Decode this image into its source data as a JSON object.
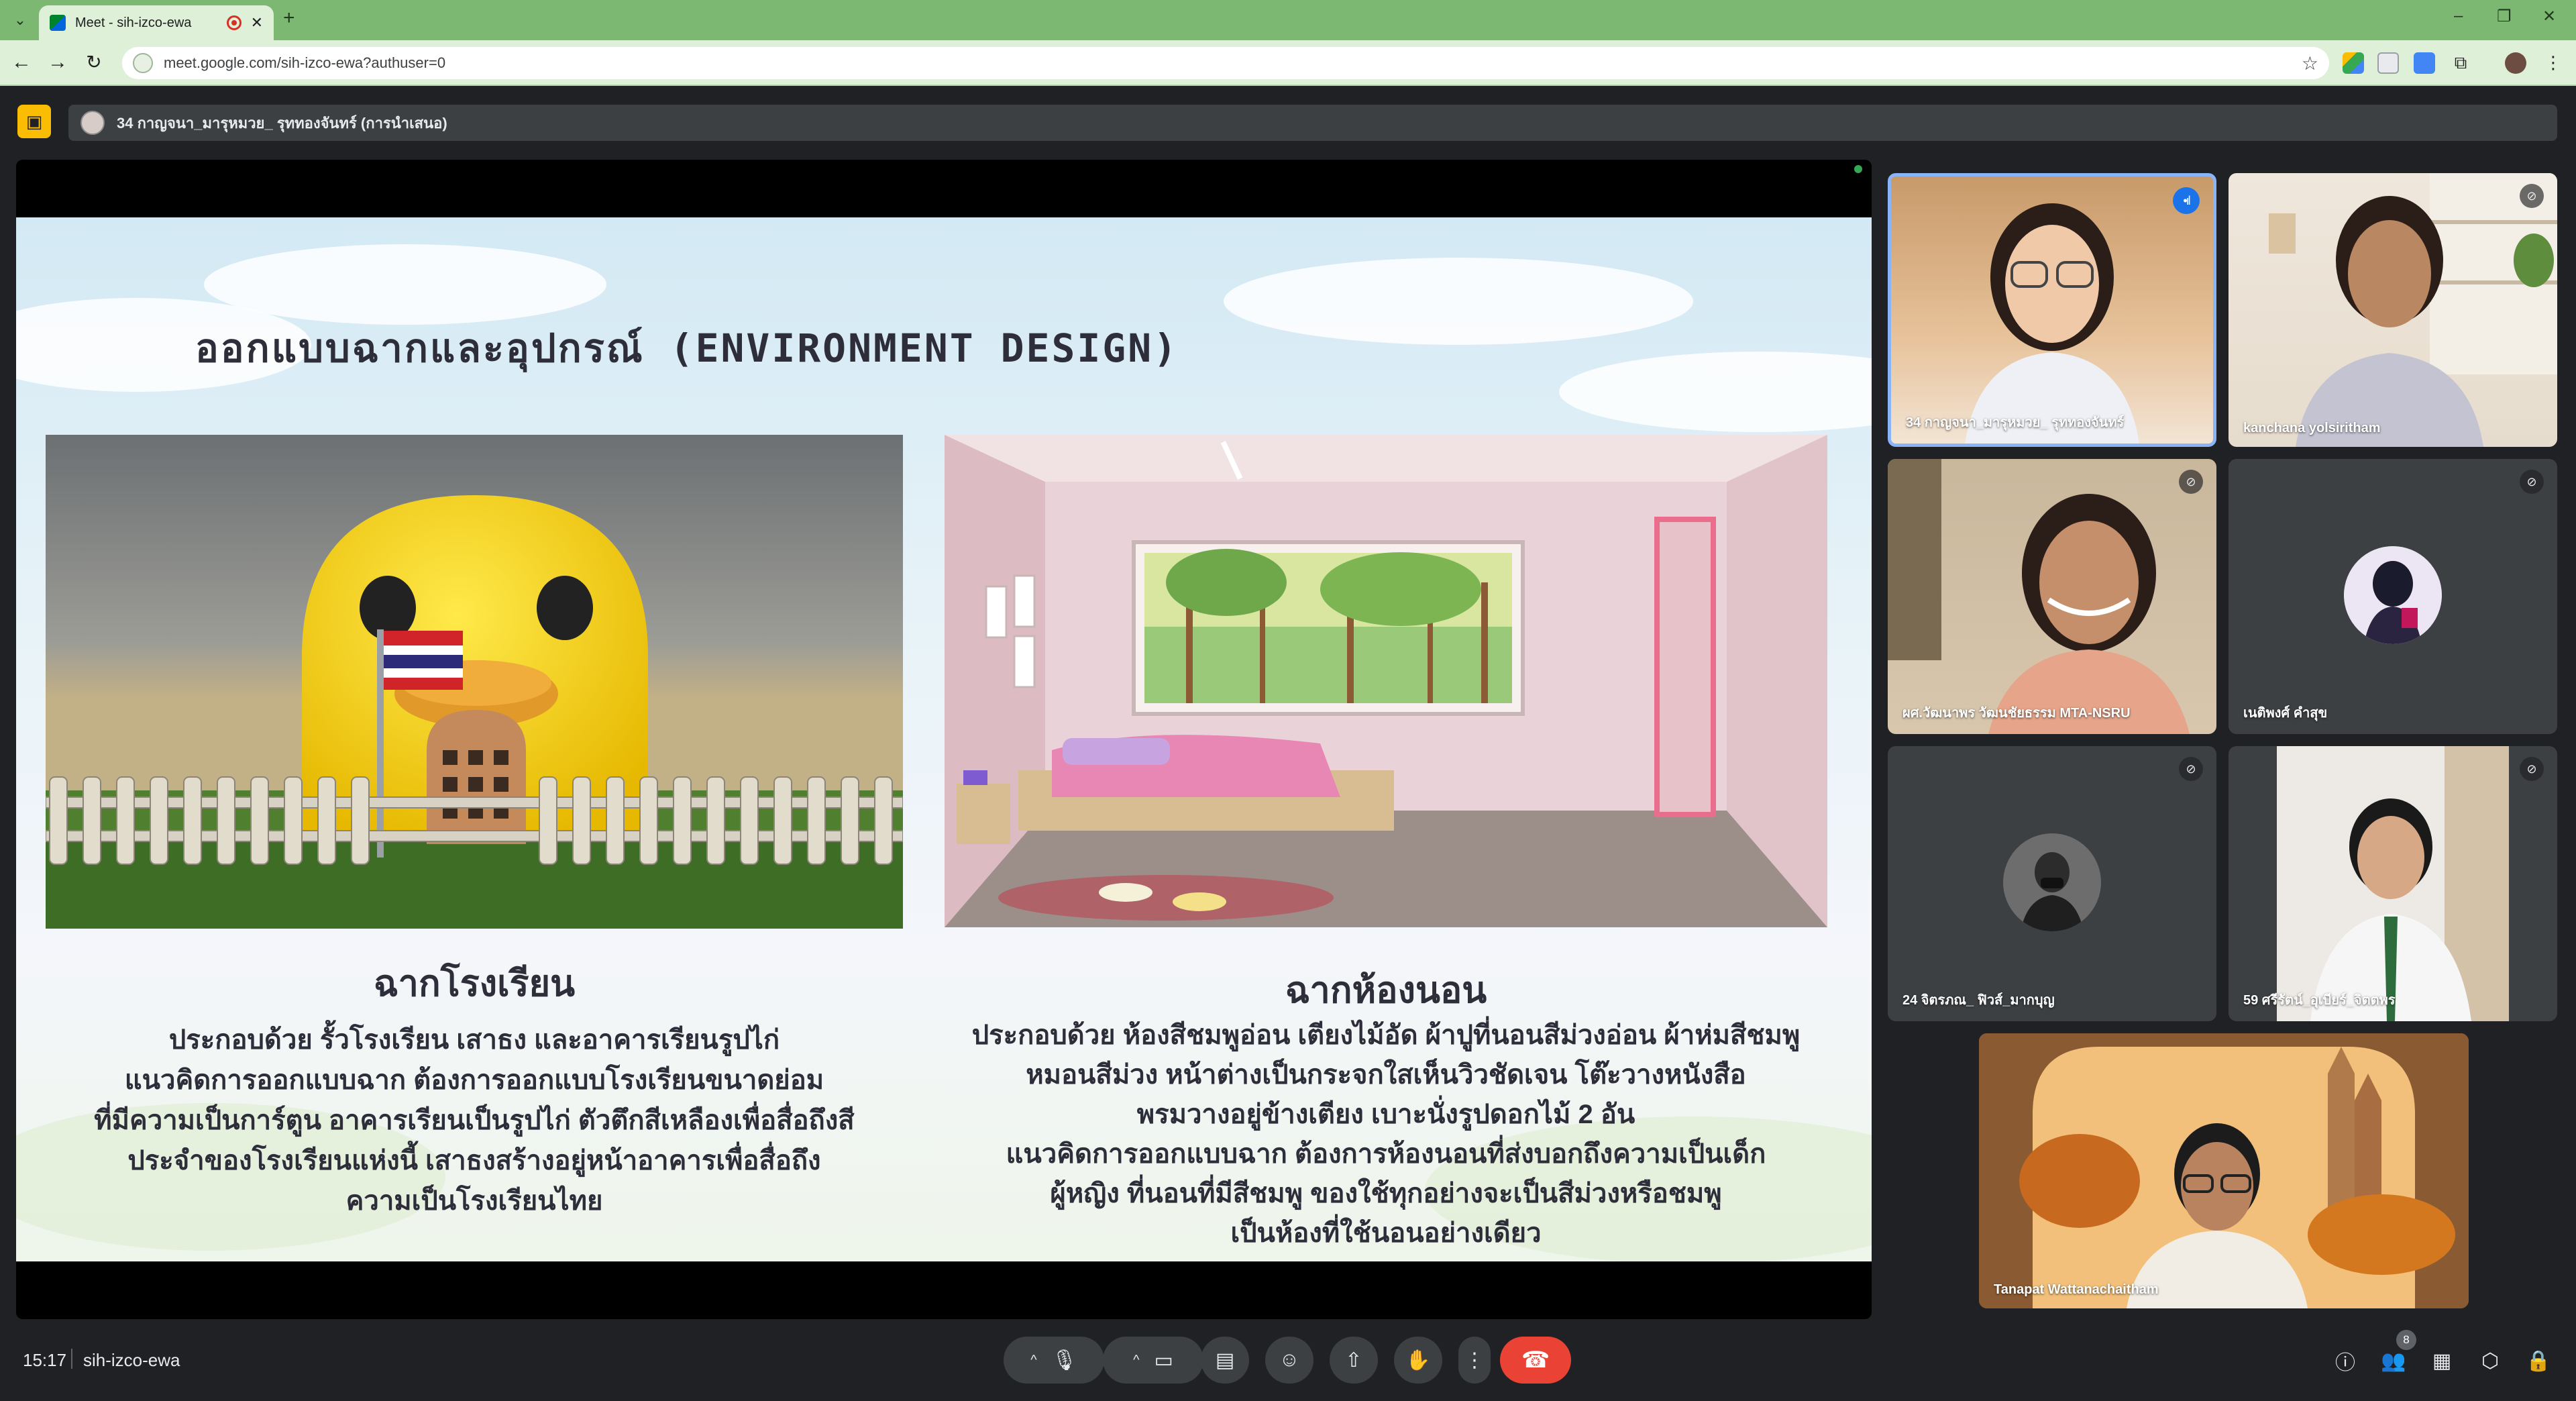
{
  "browser": {
    "tab_title": "Meet - sih-izco-ewa",
    "url": "meet.google.com/sih-izco-ewa?authuser=0"
  },
  "meet": {
    "presenter_label": "34 กาญจนา_มารุหมวย_ รุททองจันทร์ (การนำเสนอ)",
    "time": "15:17",
    "meeting_code": "sih-izco-ewa",
    "participant_count": "8"
  },
  "slide": {
    "title": "ออกแบบฉากและอุปกรณ์ (ENVIRONMENT DESIGN)",
    "left": {
      "heading": "ฉากโรงเรียน",
      "body": [
        "ประกอบด้วย รั้วโรงเรียน เสาธง และอาคารเรียนรูปไก่",
        "แนวคิดการออกแบบฉาก ต้องการออกแบบโรงเรียนขนาดย่อม",
        "ที่มีความเป็นการ์ตูน อาคารเรียนเป็นรูปไก่ ตัวตึกสีเหลืองเพื่อสื่อถึงสี",
        "ประจำของโรงเรียนแห่งนี้ เสาธงสร้างอยู่หน้าอาคารเพื่อสื่อถึง",
        "ความเป็นโรงเรียนไทย"
      ]
    },
    "right": {
      "heading": "ฉากห้องนอน",
      "body": [
        "ประกอบด้วย ห้องสีชมพูอ่อน เตียงไม้อัด ผ้าปูที่นอนสีม่วงอ่อน ผ้าห่มสีชมพู",
        "หมอนสีม่วง หน้าต่างเป็นกระจกใสเห็นวิวชัดเจน โต๊ะวางหนังสือ",
        "พรมวางอยู่ข้างเตียง เบาะนั่งรูปดอกไม้ 2 อัน",
        "แนวคิดการออกแบบฉาก ต้องการห้องนอนที่ส่งบอกถึงความเป็นเด็ก",
        "ผู้หญิง ที่นอนที่มีสีชมพู ของใช้ทุกอย่างจะเป็นสีม่วงหรือชมพู",
        "เป็นห้องที่ใช้นอนอย่างเดียว"
      ]
    }
  },
  "participants": [
    {
      "name": "34 กาญจนา_มารุหมวย_ รุททองจันทร์",
      "state": "speaking"
    },
    {
      "name": "kanchana yolsiritham",
      "state": "muted"
    },
    {
      "name": "ผศ.วัฒนาพร วัฒนชัยธรรม MTA-NSRU",
      "state": "muted"
    },
    {
      "name": "เนติพงศ์ คำสุข",
      "state": "muted"
    },
    {
      "name": "24 จิตรภณ_ ฟิวส์_มากบุญ",
      "state": "muted"
    },
    {
      "name": "59 ศรีรัตน์_อุเบียร์_จิตตพร",
      "state": "muted"
    },
    {
      "name": "Tanapat Wattanachaitham",
      "state": "active"
    }
  ],
  "icons": {
    "mic": "mic-icon",
    "camera": "camera-icon",
    "captions": "captions-icon",
    "emoji": "emoji-icon",
    "present": "present-icon",
    "hand": "raise-hand-icon",
    "more": "more-vert-icon",
    "end": "end-call-icon",
    "info": "info-icon",
    "people": "people-icon",
    "chat": "chat-icon",
    "activities": "activities-icon",
    "host": "host-controls-icon"
  },
  "colors": {
    "accent_green": "#7cb872",
    "end_call": "#ea4335",
    "speaking_blue": "#1a73e8",
    "present_yellow": "#fbbc04"
  }
}
